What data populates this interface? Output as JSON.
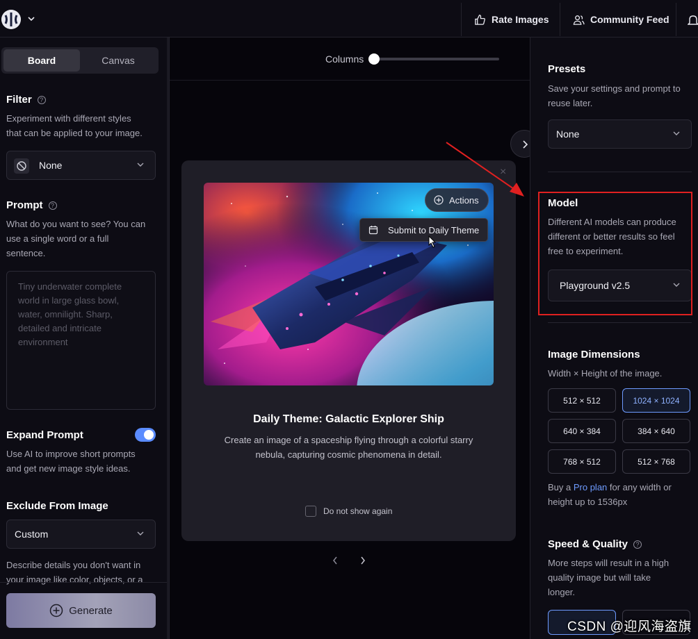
{
  "topbar": {
    "rate_images": "Rate Images",
    "community_feed": "Community Feed"
  },
  "left": {
    "tabs": [
      {
        "label": "Board",
        "active": true
      },
      {
        "label": "Canvas",
        "active": false
      }
    ],
    "filter": {
      "title": "Filter",
      "desc_lines": [
        "Experiment with different styles",
        "that can be applied to your image."
      ],
      "value": "None"
    },
    "prompt": {
      "title": "Prompt",
      "desc_lines": [
        "What do you want to see? You can",
        "use a single word or a full",
        "sentence."
      ],
      "placeholder_lines": [
        "Tiny underwater complete",
        "world in large glass bowl,",
        "water, omnilight. Sharp,",
        "detailed and intricate",
        "environment"
      ]
    },
    "expand_prompt": {
      "title": "Expand Prompt",
      "desc_lines": [
        "Use AI to improve short prompts",
        "and get new image style ideas."
      ],
      "enabled": true
    },
    "exclude": {
      "title": "Exclude From Image",
      "value": "Custom",
      "desc_lines": [
        "Describe details you don't want in",
        "your image like color, objects, or a"
      ]
    },
    "generate_label": "Generate"
  },
  "center": {
    "columns_label": "Columns",
    "columns_value": 0,
    "modal": {
      "close": "×",
      "actions_label": "Actions",
      "submit_label": "Submit to Daily Theme",
      "title": "Daily Theme: Galactic Explorer Ship",
      "desc_lines": [
        "Create an image of a spaceship flying through a colorful starry",
        "nebula, capturing cosmic phenomena in detail."
      ],
      "dont_show": "Do not show again"
    }
  },
  "right": {
    "presets": {
      "title": "Presets",
      "desc_lines": [
        "Save your settings and prompt to",
        "reuse later."
      ],
      "value": "None"
    },
    "model": {
      "title": "Model",
      "desc_lines": [
        "Different AI models can produce",
        "different or better results so feel",
        "free to experiment."
      ],
      "value": "Playground v2.5"
    },
    "dimensions": {
      "title": "Image Dimensions",
      "desc": "Width × Height of the image.",
      "options": [
        "512 × 512",
        "1024 × 1024",
        "640 × 384",
        "384 × 640",
        "768 × 512",
        "512 × 768"
      ],
      "selected": "1024 × 1024",
      "pro_prefix": "Buy a ",
      "pro_link": "Pro plan",
      "pro_suffix": " for any width or",
      "pro_line2": "height up to 1536px"
    },
    "speed": {
      "title": "Speed & Quality",
      "desc_lines": [
        "More steps will result in a high",
        "quality image but will take",
        "longer."
      ]
    }
  },
  "overlay": {
    "watermark": "CSDN @迎风海盗旗",
    "annotation_color": "#e02020"
  }
}
